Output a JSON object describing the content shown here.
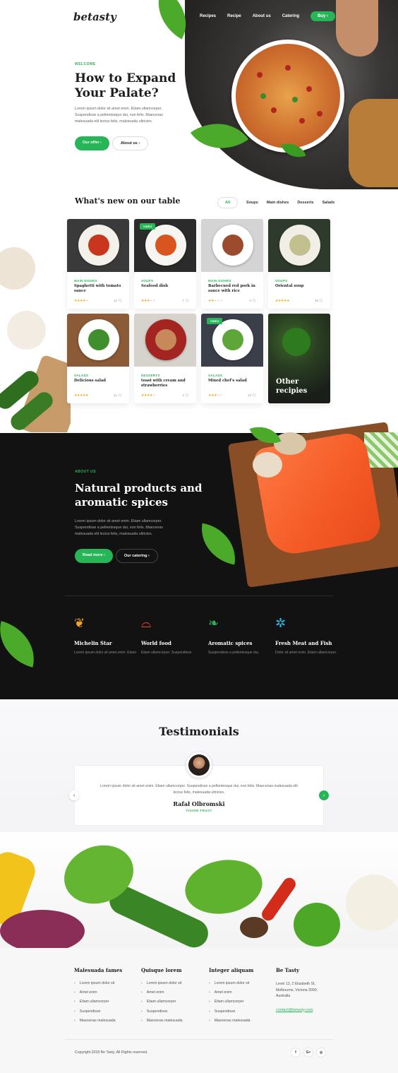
{
  "brand": {
    "logo": "betasty",
    "accent": "#27b657"
  },
  "nav": {
    "items": [
      "Recipes",
      "Recipe",
      "About us",
      "Catering"
    ],
    "buy": "Buy"
  },
  "hero": {
    "eyebrow": "WELCOME",
    "title": "How to Expand Your Palate?",
    "text": "Lorem ipsum dolor sit amet enim. Etiam ullamcorper. Suspendisse a pellentesque dui, non felis. Maecenas malesuada elit lectus felis, malesuada ultricies.",
    "primary": "Our offer",
    "secondary": "About us"
  },
  "table": {
    "title": "What's new on our table",
    "tabs": [
      "All",
      "Soups",
      "Main dishes",
      "Desserts",
      "Salads"
    ],
    "cards": [
      {
        "cat": "MAIN DISHES",
        "name": "Spaghetti with tomato sauce",
        "rating": 4,
        "count": "12",
        "video": false
      },
      {
        "cat": "SOUPS",
        "name": "Seafood dish",
        "rating": 3,
        "count": "7",
        "video": true
      },
      {
        "cat": "MAIN DISHES",
        "name": "Barbecued red pork in sauce with rice",
        "rating": 2,
        "count": "0",
        "video": false
      },
      {
        "cat": "SOUPS",
        "name": "Oriental soup",
        "rating": 5,
        "count": "25",
        "video": false
      },
      {
        "cat": "SALADS",
        "name": "Delicious salad",
        "rating": 5,
        "count": "21",
        "video": false
      },
      {
        "cat": "DESSERTS",
        "name": "toast with cream and strawberries",
        "rating": 4,
        "count": "3",
        "video": false
      },
      {
        "cat": "SALADS",
        "name": "Mixed chef's salad",
        "rating": 3,
        "count": "13",
        "video": true
      }
    ],
    "video_label": "VIDEO",
    "other": "Other recipies"
  },
  "about": {
    "eyebrow": "ABOUT US",
    "title": "Natural products and aromatic spices",
    "text": "Lorem ipsum dolor sit amet enim. Etiam ullamcorper. Suspendisse a pellentesque dui, non felis. Maecenas malesuada elit lectus felis, malesuada ultricies.",
    "primary": "Read more",
    "secondary": "Our catering"
  },
  "features": [
    {
      "icon": "laurel-icon",
      "title": "Michelin Star",
      "text": "Lorem ipsum dolor sit amet enim. Etiam",
      "color": "#f2a61f"
    },
    {
      "icon": "cloche-icon",
      "title": "World food",
      "text": "Etiam ullamcorper. Suspendisse",
      "color": "#e8452b"
    },
    {
      "icon": "herbs-icon",
      "title": "Aromatic spices",
      "text": "Suspendisse a pellentesque dui,",
      "color": "#27b657"
    },
    {
      "icon": "fish-icon",
      "title": "Fresh Meat and Fish",
      "text": "Dolor sit amet enim. Etiam ullamcorper.",
      "color": "#2fb6e0"
    }
  ],
  "testimonials": {
    "title": "Testimonials",
    "quote": "Lorem ipsum dolor sit amet enim. Etiam ullamcorper. Suspendisse a pellentesque dui, non felis. Maecenas malesuada elit lectus felis, malesuada ultricies.",
    "author": "Rafał Olbromski",
    "role": "VISION TRUST",
    "prev": "‹",
    "next": "›",
    "dots": 4,
    "active_dot": 2
  },
  "footer": {
    "cols": [
      {
        "title": "Malesuada fames",
        "items": [
          "Lorem ipsum dolor sit",
          "Amet enim",
          "Etiam ullamcorper",
          "Suspendisse",
          "Maecenas malesuada"
        ]
      },
      {
        "title": "Quisque lorem",
        "items": [
          "Lorem ipsum dolor sit",
          "Amet enim",
          "Etiam ullamcorper",
          "Suspendisse",
          "Maecenas malesuada"
        ]
      },
      {
        "title": "Integer aliquam",
        "items": [
          "Lorem ipsum dolor sit",
          "Amet enim",
          "Etiam ullamcorper",
          "Suspendisse",
          "Maecenas malesuada"
        ]
      }
    ],
    "contact": {
      "title": "Be Tasty",
      "address": "Level 13, 2 Elizabeth St, Melbourne, Victoria 3000, Australia",
      "email": "contact@betasty.com"
    },
    "copyright": "Copyright 2018 Be Tasty. All Rights reserved.",
    "social": [
      "f",
      "G+",
      "◎"
    ]
  }
}
